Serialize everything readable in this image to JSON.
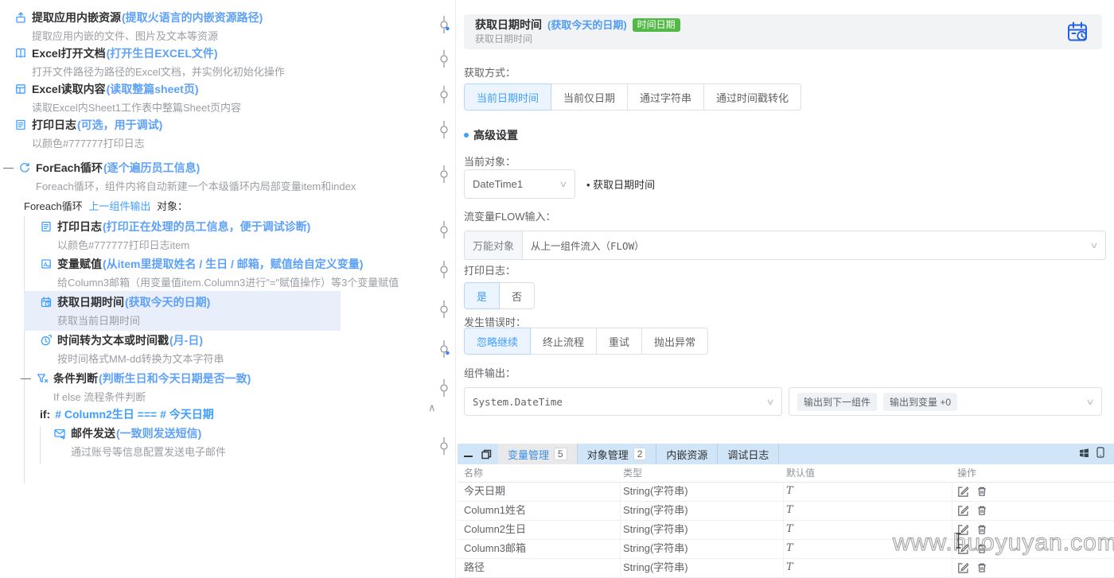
{
  "colors": {
    "primary": "#409eff",
    "badge_green": "#52b946",
    "selected_row": "#e9eefb",
    "tab_strip": "#d0e5f8"
  },
  "left_tree": {
    "items": [
      {
        "title": "提取应用内嵌资源",
        "note": "(提取火语言的内嵌资源路径)",
        "desc": "提取应用内嵌的文件、图片及文本等资源"
      },
      {
        "title": "Excel打开文档",
        "note": "(打开生日EXCEL文件)",
        "desc": "打开文件路径为路径的Excel文档，并实例化初始化操作"
      },
      {
        "title": "Excel读取内容",
        "note": "(读取整篇sheet页)",
        "desc": "读取Excel内Sheet1工作表中整篇Sheet页内容"
      },
      {
        "title": "打印日志",
        "note": "(可选，用于调试)",
        "desc": "以颜色#777777打印日志"
      },
      {
        "title": "ForEach循环",
        "note": "(逐个遍历员工信息)",
        "desc": "Foreach循环，组件内将自动新建一个本级循环内局部变量item和index",
        "collapse": "—"
      },
      {
        "title": "打印日志",
        "note": "(打印正在处理的员工信息，便于调试诊断)",
        "desc": "以颜色#777777打印日志item"
      },
      {
        "title": "变量赋值",
        "note": "(从item里提取姓名 / 生日 / 邮箱，赋值给自定义变量)",
        "desc": "给Column3邮箱（用变量值item.Column3进行\"=\"赋值操作）等3个变量赋值"
      },
      {
        "title": "获取日期时间",
        "note": "(获取今天的日期)",
        "desc": "获取当前日期时间"
      },
      {
        "title": "时间转为文本或时间戳",
        "note": "(月-日)",
        "desc": "按时间格式MM-dd转换为文本字符串"
      },
      {
        "title": "条件判断",
        "note": "(判断生日和今天日期是否一致)",
        "desc": "If else 流程条件判断",
        "collapse": "—"
      },
      {
        "title": "邮件发送",
        "note": "(一致则发送短信)",
        "desc": "通过账号等信息配置发送电子邮件"
      }
    ],
    "loop_header": {
      "prefix": "Foreach循环",
      "link": "上一组件输出",
      "suffix": "对象："
    },
    "if_line": {
      "keyword": "if:",
      "expression": "# Column2生日 === # 今天日期"
    },
    "collapse_up": "∧"
  },
  "props": {
    "header": {
      "title": "获取日期时间",
      "note": "(获取今天的日期)",
      "badge": "时间日期",
      "subtitle": "获取日期时间"
    },
    "fetch_mode": {
      "label": "获取方式：",
      "options": [
        "当前日期时间",
        "当前仅日期",
        "通过字符串",
        "通过时间戳转化"
      ],
      "selected": "当前日期时间"
    },
    "advanced_label": "高级设置",
    "current_object": {
      "label": "当前对象：",
      "value": "DateTime1",
      "hint": "• 获取日期时间"
    },
    "flow_input": {
      "label": "流变量FLOW输入：",
      "tag": "万能对象",
      "value": "从上一组件流入（FLOW）"
    },
    "print_log": {
      "label": "打印日志：",
      "options": [
        "是",
        "否"
      ],
      "selected": "是"
    },
    "on_error": {
      "label": "发生错误时：",
      "options": [
        "忽略继续",
        "终止流程",
        "重试",
        "抛出异常"
      ],
      "selected": "忽略继续"
    },
    "output": {
      "label": "组件输出：",
      "type": "System.DateTime",
      "targets": [
        "输出到下一组件",
        "输出到变量 +0"
      ]
    }
  },
  "bottom": {
    "tabs": [
      {
        "label": "变量管理",
        "count": "5"
      },
      {
        "label": "对象管理",
        "count": "2"
      },
      {
        "label": "内嵌资源"
      },
      {
        "label": "调试日志"
      }
    ],
    "table": {
      "headers": [
        "名称",
        "类型",
        "默认值",
        "操作"
      ],
      "rows": [
        {
          "name": "今天日期",
          "type": "String(字符串)",
          "marker": "T"
        },
        {
          "name": "Column1姓名",
          "type": "String(字符串)",
          "marker": "T"
        },
        {
          "name": "Column2生日",
          "type": "String(字符串)",
          "marker": "T"
        },
        {
          "name": "Column3邮箱",
          "type": "String(字符串)",
          "marker": "T"
        },
        {
          "name": "路径",
          "type": "String(字符串)",
          "marker": "T"
        }
      ]
    }
  },
  "watermark": "www.huoyuyan.com"
}
